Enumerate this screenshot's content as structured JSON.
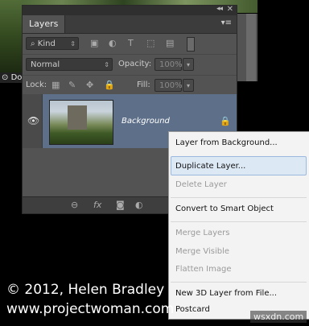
{
  "doc_tab": "Doc",
  "panel": {
    "tab_label": "Layers",
    "filter": {
      "value": "Kind"
    },
    "blend_mode": {
      "value": "Normal"
    },
    "opacity": {
      "label": "Opacity:",
      "value": "100%"
    },
    "lock": {
      "label": "Lock:"
    },
    "fill": {
      "label": "Fill:",
      "value": "100%"
    },
    "layer": {
      "name": "Background"
    }
  },
  "context_menu": {
    "items": [
      {
        "label": "Layer from Background...",
        "enabled": true
      },
      {
        "label": "Duplicate Layer...",
        "enabled": true,
        "highlighted": true
      },
      {
        "label": "Delete Layer",
        "enabled": false
      },
      {
        "label": "Convert to Smart Object",
        "enabled": true
      },
      {
        "label": "Merge Layers",
        "enabled": false
      },
      {
        "label": "Merge Visible",
        "enabled": false
      },
      {
        "label": "Flatten Image",
        "enabled": false
      },
      {
        "label": "New 3D Layer from File...",
        "enabled": true
      },
      {
        "label": "Postcard",
        "enabled": true
      }
    ]
  },
  "overlay": {
    "copyright": "© 2012, Helen Bradley",
    "website": "www.projectwoman.com",
    "watermark": "wsxdn.com"
  }
}
